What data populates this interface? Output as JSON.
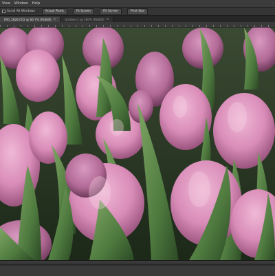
{
  "menubar": {
    "items": [
      "View",
      "Window",
      "Help"
    ]
  },
  "options": {
    "scroll_all_label": "Scroll All Windows",
    "buttons": [
      "Actual Pixels",
      "Fit Screen",
      "Fill Screen",
      "Print Size"
    ]
  },
  "tabs": [
    {
      "label": "IMG_5828.CR2 @ 66.7% (RGB/8)",
      "active": true
    },
    {
      "label": "Untitled-1 @ 100% (RGB/8)",
      "active": false
    }
  ],
  "colors": {
    "chrome_dark": "#2b2b2b",
    "petal_pink": "#d98cb8",
    "leaf_green": "#4f7a3f"
  }
}
